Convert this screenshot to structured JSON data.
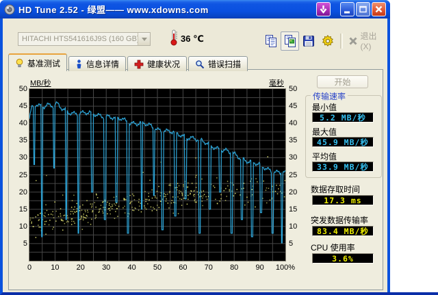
{
  "window": {
    "title": "HD Tune 2.52 - 绿盟—— www.xdowns.com"
  },
  "toolbar": {
    "drive_value": "HITACHI HTS541616J9S (160 GB)",
    "temperature": "36 ℃",
    "exit_label": "退出(X)"
  },
  "tabs": [
    {
      "label": "基准测试",
      "icon": "lightbulb",
      "active": true
    },
    {
      "label": "信息详情",
      "icon": "info",
      "active": false
    },
    {
      "label": "健康状况",
      "icon": "health-cross",
      "active": false
    },
    {
      "label": "错误扫描",
      "icon": "magnifier",
      "active": false
    }
  ],
  "panel": {
    "start_label": "开始",
    "group_title": "传输速率",
    "metrics": [
      {
        "label": "最小值",
        "value": "5.2 MB/秒"
      },
      {
        "label": "最大值",
        "value": "45.9 MB/秒"
      },
      {
        "label": "平均值",
        "value": "33.9 MB/秒"
      }
    ],
    "extras": [
      {
        "label": "数据存取时间",
        "value": "17.3 ms"
      },
      {
        "label": "突发数据传输率",
        "value": "83.4 MB/秒"
      },
      {
        "label": "CPU 使用率",
        "value": "3.6%"
      }
    ]
  },
  "colors": {
    "frame": "#0a52de",
    "plot_bg": "#000000",
    "grid": "#474747",
    "line": "#2ea8dc",
    "scatter": "#dcdc6e",
    "lcd_cyan": "#35c0f0",
    "lcd_yellow": "#f0f000",
    "group_title": "#2742c8"
  },
  "chart_data": {
    "type": "line",
    "title": "HD Tune benchmark transfer-rate graph with access-time scatter",
    "left_axis": {
      "label": "MB/秒",
      "min": 0,
      "max": 50,
      "ticks": [
        50,
        45,
        40,
        35,
        30,
        25,
        20,
        15,
        10,
        5
      ]
    },
    "right_axis": {
      "label": "毫秒",
      "min": 0,
      "max": 50,
      "ticks": [
        50,
        45,
        40,
        35,
        30,
        25,
        20,
        15,
        10,
        5
      ]
    },
    "x_axis": {
      "min": 0,
      "max": 100,
      "tick_labels": [
        "0",
        "10",
        "20",
        "30",
        "40",
        "50",
        "60",
        "70",
        "80",
        "90",
        "100%"
      ]
    },
    "grid": {
      "x_step_pct": 5,
      "y_step": 2.5
    },
    "series": [
      {
        "name": "transfer-rate (MB/s)",
        "style": "line",
        "base_points": [
          [
            0,
            41
          ],
          [
            0.8,
            44
          ],
          [
            2.5,
            45.3
          ],
          [
            5,
            45
          ],
          [
            7,
            45.7
          ],
          [
            9,
            45.2
          ],
          [
            11,
            45.4
          ],
          [
            13,
            43.8
          ],
          [
            16,
            43.2
          ],
          [
            20,
            43
          ],
          [
            23,
            42.8
          ],
          [
            27,
            42.5
          ],
          [
            31,
            42
          ],
          [
            34,
            41
          ],
          [
            36,
            41.3
          ],
          [
            39,
            40.4
          ],
          [
            42,
            40
          ],
          [
            45,
            39.7
          ],
          [
            48,
            39
          ],
          [
            51,
            38.2
          ],
          [
            54,
            37.6
          ],
          [
            57,
            37
          ],
          [
            60,
            36.4
          ],
          [
            63,
            36
          ],
          [
            66,
            35
          ],
          [
            69,
            34.2
          ],
          [
            72,
            33.4
          ],
          [
            75,
            32.4
          ],
          [
            78,
            31.4
          ],
          [
            81,
            30.6
          ],
          [
            84,
            29.6
          ],
          [
            87,
            28.6
          ],
          [
            90,
            27.6
          ],
          [
            93,
            26.8
          ],
          [
            96,
            26
          ],
          [
            100,
            25.3
          ]
        ],
        "dips": [
          [
            1.8,
            28
          ],
          [
            4.8,
            7
          ],
          [
            9.6,
            27
          ],
          [
            14.4,
            12
          ],
          [
            19.2,
            8
          ],
          [
            24.5,
            20
          ],
          [
            29.5,
            12
          ],
          [
            34,
            17
          ],
          [
            38.5,
            8
          ],
          [
            43.8,
            15
          ],
          [
            48.7,
            19
          ],
          [
            52,
            9
          ],
          [
            57,
            13
          ],
          [
            61,
            18
          ],
          [
            66.5,
            8
          ],
          [
            70.5,
            15
          ],
          [
            74.5,
            20
          ],
          [
            79,
            8
          ],
          [
            83,
            12
          ],
          [
            87,
            7
          ],
          [
            90.5,
            14
          ],
          [
            95,
            8
          ],
          [
            98.7,
            5.2
          ]
        ]
      },
      {
        "name": "access-time scatter (ms)",
        "style": "scatter",
        "estimated": true,
        "seed": 7,
        "count": 470,
        "band": "centre rises from ~11.5 ms at 0% to ~20 ms at 65%, spread ±4 ms, sparser beyond 68%"
      }
    ],
    "stats": {
      "min_mbs": 5.2,
      "max_mbs": 45.9,
      "avg_mbs": 33.9,
      "access_ms": 17.3,
      "burst_mbs": 83.4,
      "cpu_pct": 3.6
    }
  }
}
